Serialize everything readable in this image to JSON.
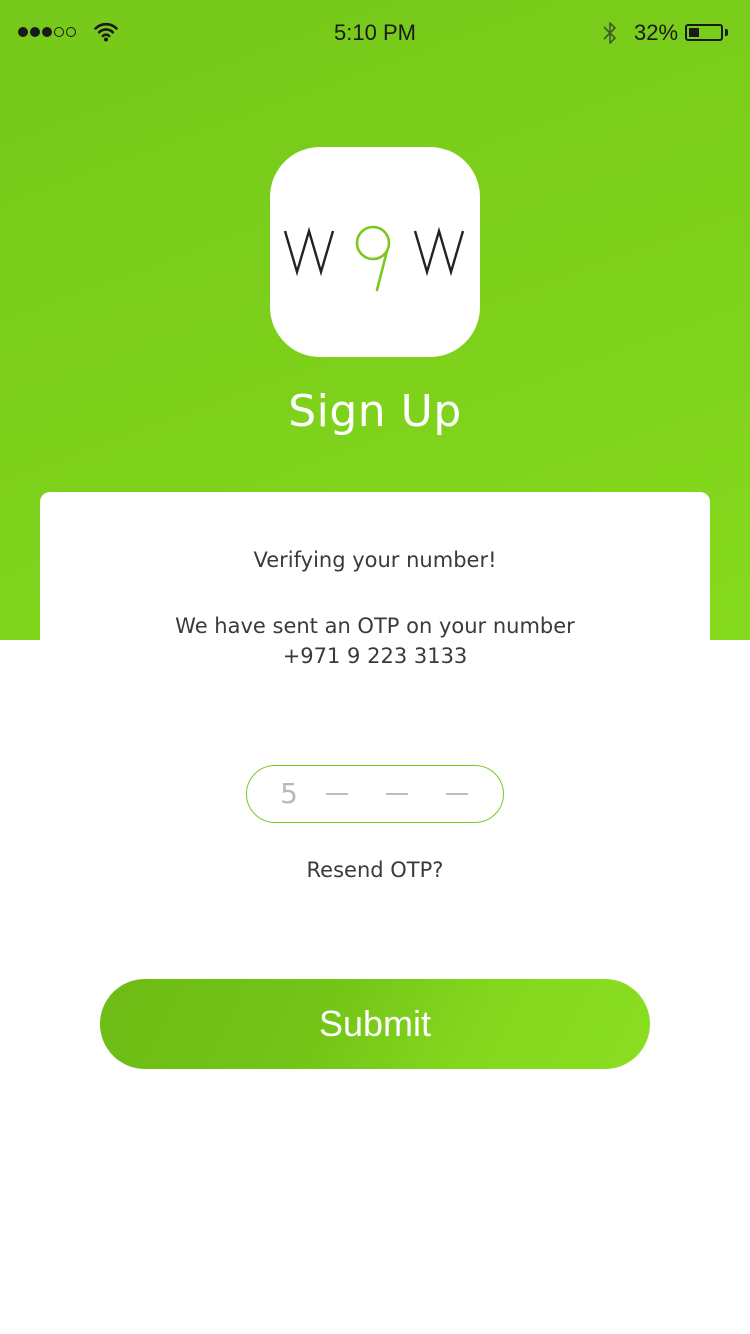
{
  "status_bar": {
    "time": "5:10 PM",
    "battery_percent": "32%",
    "battery_level": 0.32,
    "signal_bars": 3,
    "signal_max": 5
  },
  "header": {
    "logo_text": "W9W",
    "title": "Sign Up"
  },
  "verification": {
    "heading": "Verifying your number!",
    "description": "We have sent an OTP on your number",
    "phone_number": "+971 9 223 3133"
  },
  "otp": {
    "digits": [
      "5",
      "",
      "",
      ""
    ]
  },
  "resend_label": "Resend OTP?",
  "submit_label": "Submit",
  "colors": {
    "brand_green": "#7cc820",
    "text_dark": "#3a3a3a",
    "placeholder_gray": "#b9b9b9"
  }
}
